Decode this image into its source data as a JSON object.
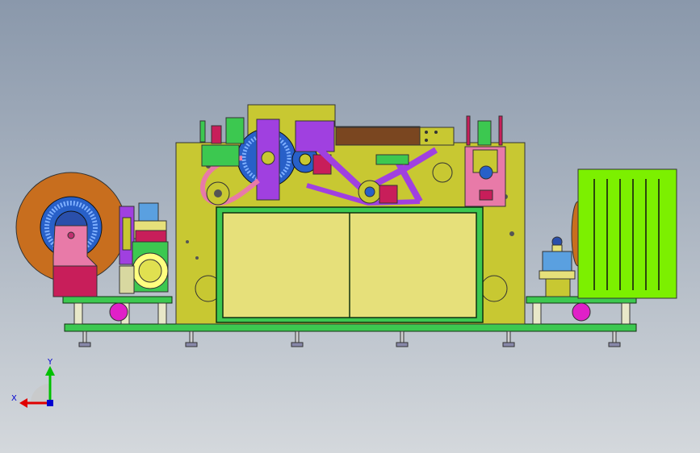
{
  "view": {
    "background_top": "#8a98ab",
    "background_bottom": "#d4d8dc"
  },
  "triad": {
    "x_label": "X",
    "y_label": "Y",
    "x_color": "#e00000",
    "y_color": "#00c000",
    "z_color": "#0000d0"
  },
  "colors": {
    "frame": "#c8c832",
    "panel": "#e6e07a",
    "base": "#3cc850",
    "reel_outer": "#c86e1e",
    "reel_inner": "#2860c8",
    "magenta": "#cc33cc",
    "lime": "#7cf000",
    "pink": "#e87aa8",
    "purple": "#a040e0",
    "brown": "#7a4620"
  }
}
